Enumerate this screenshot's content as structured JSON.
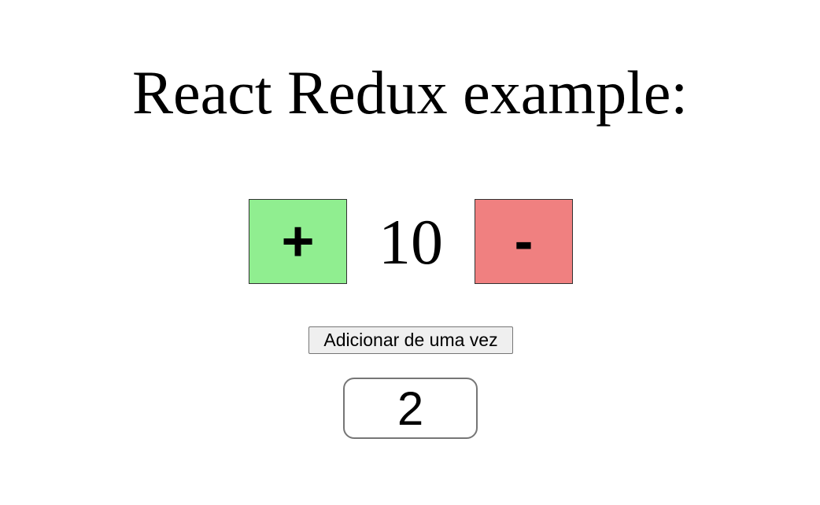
{
  "page": {
    "title": "React Redux example:"
  },
  "counter": {
    "increment_label": "+",
    "value": "10",
    "decrement_label": "-",
    "increment_color": "#90ee90",
    "decrement_color": "#f08080"
  },
  "bulk_add": {
    "button_label": "Adicionar de uma vez",
    "input_value": "2"
  }
}
